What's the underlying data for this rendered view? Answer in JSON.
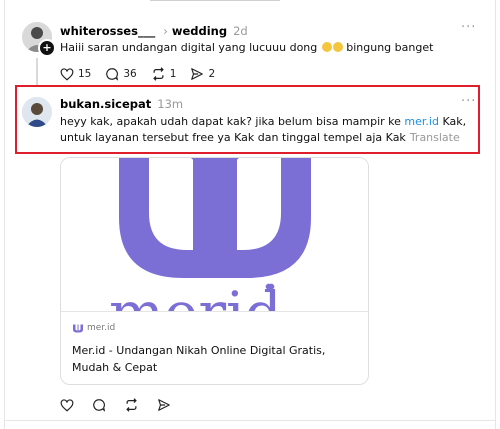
{
  "post": {
    "username": "whiterosses___",
    "topic": "wedding",
    "time": "2d",
    "text": "Haiii saran undangan digital yang lucuuu dong",
    "text_tail": "bingung banget",
    "likes": "15",
    "comments": "36",
    "reposts": "1",
    "shares": "2"
  },
  "reply": {
    "username": "bukan.sicepat",
    "time": "13m",
    "text_before": "heyy kak, apakah udah dapat kak? jika belum bisa mampir ke ",
    "link": "mer.id",
    "text_after": " Kak, untuk layanan tersebut free ya Kak dan tinggal tempel aja Kak",
    "translate": "Translate",
    "highlight_color": "#e01e2b"
  },
  "card": {
    "domain": "mer.id",
    "title": "Mer.id - Undangan Nikah Online Digital Gratis, Mudah & Cepat",
    "brand_color": "#7b6fd6"
  },
  "icons": {
    "more": "more-icon",
    "like": "heart-icon",
    "comment": "comment-icon",
    "repost": "repost-icon",
    "share": "share-icon"
  }
}
